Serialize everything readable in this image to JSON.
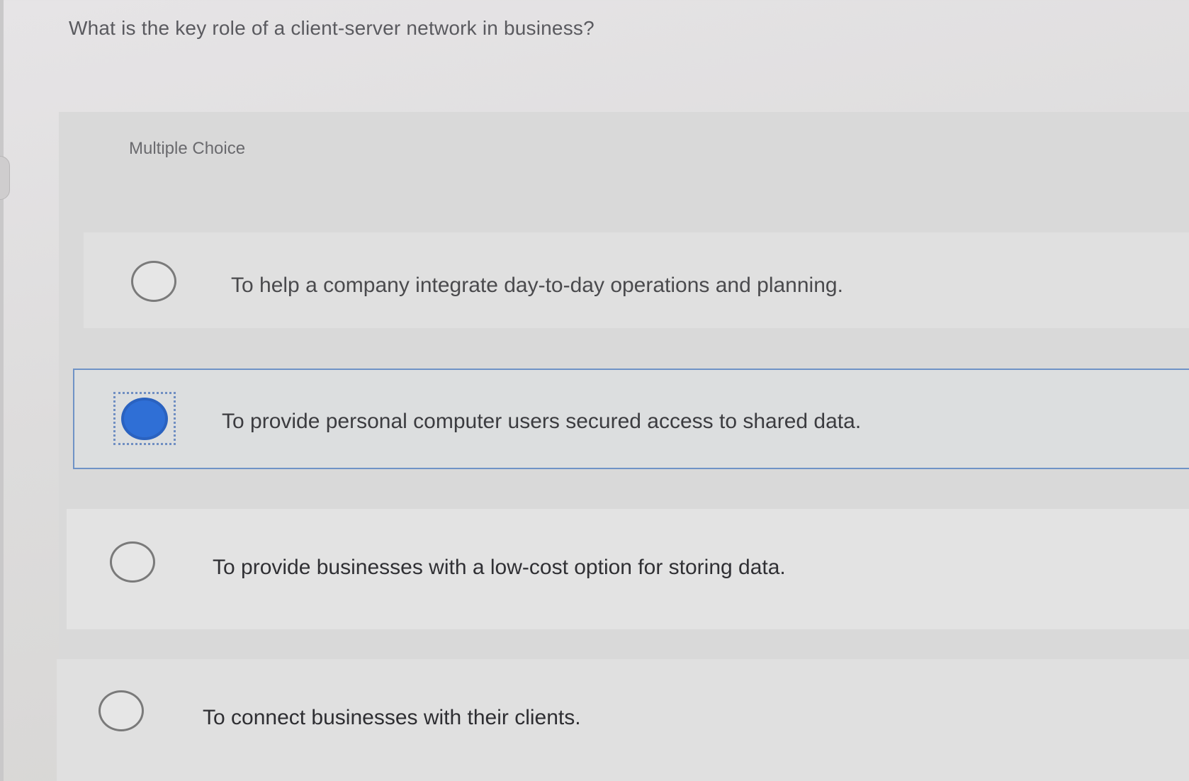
{
  "question": {
    "text": "What is the key role of a client-server network in business?"
  },
  "section": {
    "label": "Multiple Choice"
  },
  "options": [
    {
      "text": "To help a company integrate day-to-day operations and planning.",
      "selected": false
    },
    {
      "text": "To provide personal computer users secured access to shared data.",
      "selected": true
    },
    {
      "text": "To provide businesses with a low-cost option for storing data.",
      "selected": false
    },
    {
      "text": "To connect businesses with their clients.",
      "selected": false
    }
  ],
  "colors": {
    "selected_radio": "#2f6fd6",
    "selected_border": "#6f93c6"
  }
}
